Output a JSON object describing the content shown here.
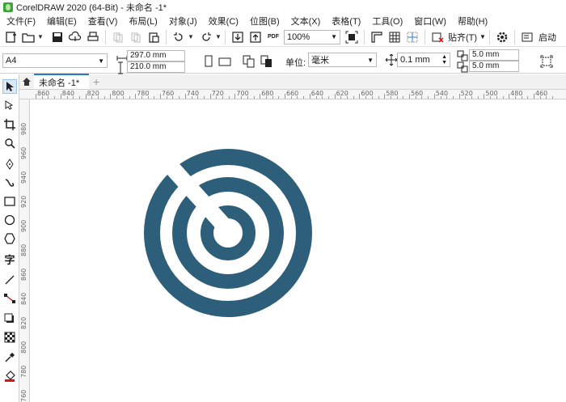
{
  "window": {
    "title": "CorelDRAW 2020 (64-Bit) - 未命名 -1*"
  },
  "menu": [
    "文件(F)",
    "编辑(E)",
    "查看(V)",
    "布局(L)",
    "对象(J)",
    "效果(C)",
    "位图(B)",
    "文本(X)",
    "表格(T)",
    "工具(O)",
    "窗口(W)",
    "帮助(H)"
  ],
  "toolbar": {
    "zoom": "100%",
    "snap_label": "贴齐(T)",
    "start_label": "启动",
    "pdf_label": "PDF"
  },
  "property_bar": {
    "page_size": "A4",
    "width": "297.0 mm",
    "height": "210.0 mm",
    "units_label": "单位:",
    "units": "毫米",
    "nudge": "0.1 mm",
    "dup_x": "5.0 mm",
    "dup_y": "5.0 mm"
  },
  "tabs": {
    "document": "未命名 -1*",
    "add": "+"
  },
  "ruler": {
    "h_labels": [
      "860",
      "840",
      "820",
      "800",
      "780",
      "760",
      "740",
      "720",
      "700",
      "680",
      "660",
      "640",
      "620",
      "600",
      "580",
      "560",
      "540",
      "520",
      "500",
      "480",
      "460"
    ],
    "v_labels": [
      "980",
      "960",
      "940",
      "920",
      "900",
      "880",
      "860",
      "840",
      "820",
      "800",
      "780",
      "760"
    ]
  },
  "colors": {
    "target": "#2e5f7a",
    "accent": "#2b79d0"
  }
}
